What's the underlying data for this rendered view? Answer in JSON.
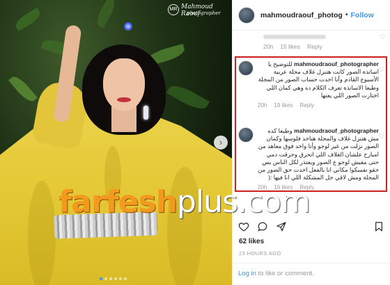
{
  "photo": {
    "watermark_logo": "MR",
    "watermark_line1": "Mahmoud Raouf",
    "watermark_line2": "photographer",
    "next_icon": "chevron-right-icon",
    "carousel_dots": 6,
    "carousel_active": 0
  },
  "site_watermark": {
    "part1": "farfesh",
    "part2": "plus.com"
  },
  "post": {
    "username": "mahmoudraouf_photogra",
    "separator": "•",
    "follow_label": "Follow"
  },
  "faded_comment": {
    "age": "20h",
    "likes": "15 likes",
    "reply": "Reply"
  },
  "comments": [
    {
      "username": "mahmoudraouf_photographer",
      "text": "للتوضيح يا اساتذة الصور كانت هتنزل غلاف مجلة عربية الأسبوع القادم وأنا اخدت حساب الصور من المجلة وطبعا الاساتذة تعرف الكلام ده وهي كمان اللي اختارت الصور اللي يعتها",
      "age": "20h",
      "likes": "19 likes",
      "reply": "Reply"
    },
    {
      "username": "mahmoudraouf_photographer",
      "text": "وطبعا كده مش هتنزل غلاف والمجلة هتاخد فلوسها وكمان الصور نزلت من غير لوجو وأنا واخد فوق معاهد من امبارح علشان الغلاف اللي اتحرق وحرقت دمي حتى مفيش لوجو ع الصور ويعتذر لكل الناس بس حقو نفسكوا مكاني انا بالفعل اخدت حق الصور من المجلة ومش لاقي حل المشكلة اللي انا فيها :(",
      "age": "20h",
      "likes": "16 likes",
      "reply": "Reply"
    }
  ],
  "actions": {
    "like_icon": "heart-icon",
    "comment_icon": "comment-icon",
    "share_icon": "share-icon",
    "save_icon": "bookmark-icon"
  },
  "likes_count": "62 likes",
  "timestamp": "23 HOURS AGO",
  "login_prompt": {
    "link": "Log in",
    "rest": " to like or comment."
  },
  "colors": {
    "accent": "#3897f0",
    "highlight_border": "#cc1f1f",
    "watermark_orange": "#f29a1e"
  }
}
